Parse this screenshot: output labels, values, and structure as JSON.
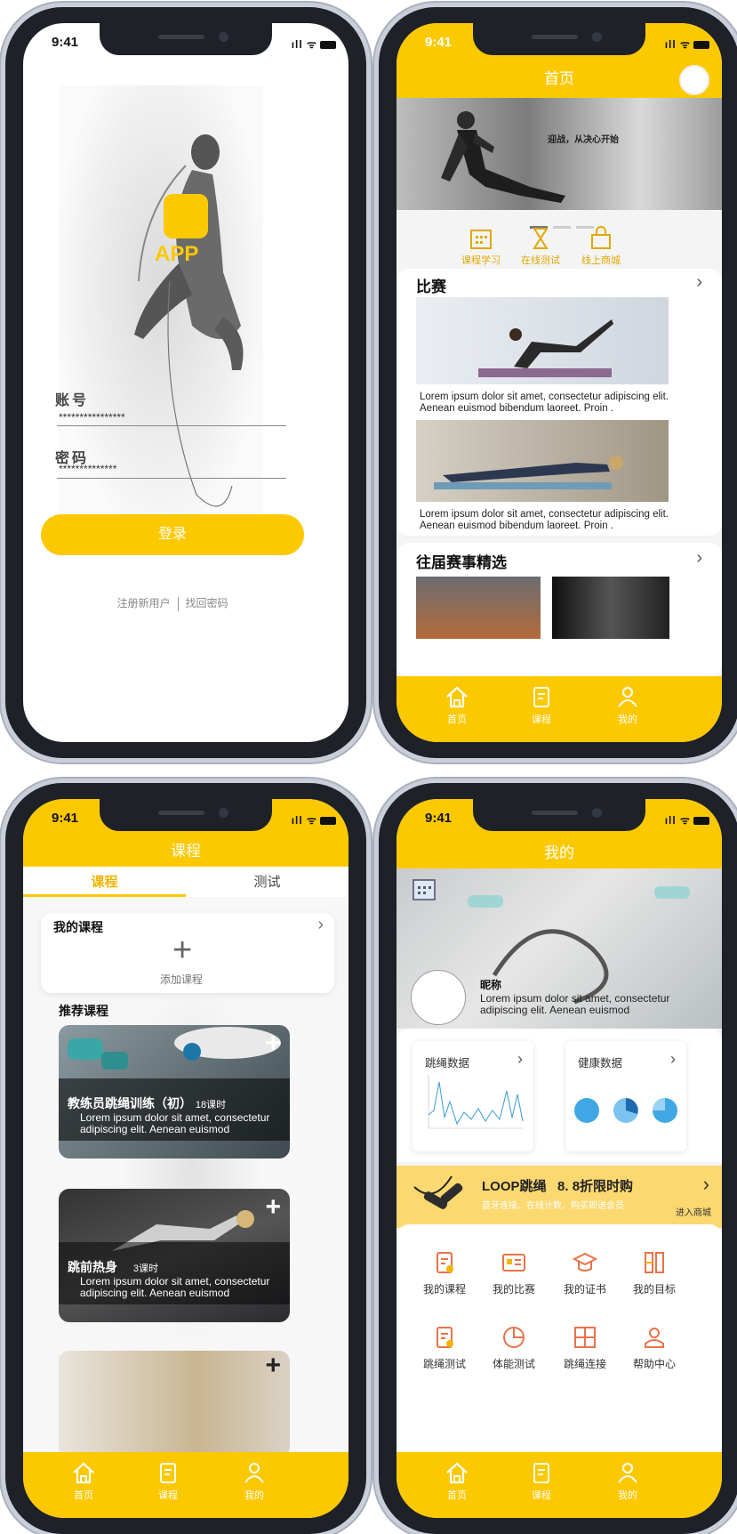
{
  "status": {
    "time": "9:41"
  },
  "login": {
    "app_label": "APP",
    "account_label": "账号",
    "account_value": "****************",
    "password_label": "密码",
    "password_value": "**************",
    "login_button": "登录",
    "register_link": "注册新用户",
    "recover_link": "找回密码"
  },
  "home": {
    "title": "首页",
    "banner_text": "迎战，从决心开始",
    "quick": [
      "课程学习",
      "在线测试",
      "线上商城"
    ],
    "match_section": "比赛",
    "items": [
      "Lorem ipsum dolor sit amet, consectetur adipiscing elit. Aenean euismod bibendum laoreet. Proin .",
      "Lorem ipsum dolor sit amet, consectetur adipiscing elit. Aenean euismod bibendum laoreet. Proin ."
    ],
    "past_section": "往届赛事精选"
  },
  "tabs": {
    "home": "首页",
    "course": "课程",
    "mine": "我的"
  },
  "course": {
    "title": "课程",
    "tab_course": "课程",
    "tab_test": "测试",
    "my_courses": "我的课程",
    "add_course": "添加课程",
    "recommended": "推荐课程",
    "cards": [
      {
        "title": "教练员跳绳训练（初）",
        "hours": "18课时",
        "desc": "Lorem ipsum dolor sit amet, consectetur adipiscing elit. Aenean euismod"
      },
      {
        "title": "跳前热身",
        "hours": "3课时",
        "desc": "Lorem ipsum dolor sit amet, consectetur adipiscing elit. Aenean euismod"
      }
    ]
  },
  "mine": {
    "title": "我的",
    "nickname": "昵称",
    "bio": "Lorem ipsum dolor sit amet, consectetur adipiscing elit. Aenean euismod",
    "jump_data": "跳绳数据",
    "health_data": "健康数据",
    "promo_title": "LOOP跳绳",
    "promo_offer": "8. 8折限时购",
    "promo_sub": "蓝牙连接、在线计数、购买即送会员",
    "promo_link": "进入商城",
    "grid": [
      "我的课程",
      "我的比赛",
      "我的证书",
      "我的目标",
      "跳绳测试",
      "体能测试",
      "跳绳连接",
      "帮助中心"
    ]
  },
  "colors": {
    "accent": "#fcc800"
  }
}
